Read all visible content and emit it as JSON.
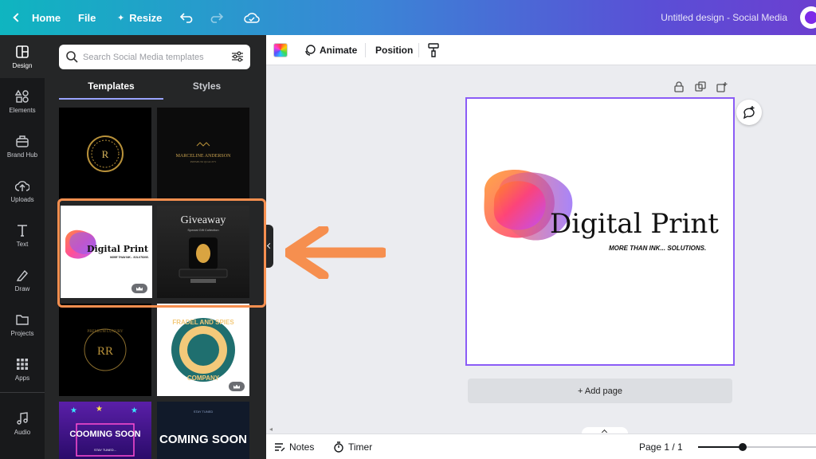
{
  "topbar": {
    "home_label": "Home",
    "file_label": "File",
    "resize_label": "Resize",
    "document_title": "Untitled design - Social Media"
  },
  "rail": {
    "items": [
      {
        "label": "Design",
        "icon": "layout-icon"
      },
      {
        "label": "Elements",
        "icon": "shapes-icon"
      },
      {
        "label": "Brand Hub",
        "icon": "briefcase-icon"
      },
      {
        "label": "Uploads",
        "icon": "upload-cloud-icon"
      },
      {
        "label": "Text",
        "icon": "text-icon"
      },
      {
        "label": "Draw",
        "icon": "pen-icon"
      },
      {
        "label": "Projects",
        "icon": "folder-icon"
      },
      {
        "label": "Apps",
        "icon": "grid-icon"
      },
      {
        "label": "Audio",
        "icon": "music-icon"
      }
    ]
  },
  "panel": {
    "search_placeholder": "Search Social Media templates",
    "tabs": [
      "Templates",
      "Styles"
    ],
    "templates": [
      {
        "id": "t1",
        "text": "R"
      },
      {
        "id": "t2",
        "text": "MARCELINE ANDERSON",
        "subtext": "PREMIUM QUALITY"
      },
      {
        "id": "t3",
        "title": "Digital Print",
        "subtitle": "MORE THAN INK... SOLUTIONS.",
        "premium": true
      },
      {
        "id": "t4",
        "title": "Giveaway",
        "subtitle": "Special Gift Collection"
      },
      {
        "id": "t5",
        "text": "PREMIUM LUXURY",
        "monogram": "RR"
      },
      {
        "id": "t6",
        "text": "FRADEL AND SPIES",
        "subtext": "COMPANY",
        "premium": true
      },
      {
        "id": "t7",
        "text": "COOMING SOON",
        "subtext": "STAY TUNED..."
      },
      {
        "id": "t8",
        "text": "COMING SOON",
        "subtext": "STAY TUNED"
      }
    ]
  },
  "toolbar": {
    "animate_label": "Animate",
    "position_label": "Position"
  },
  "canvas": {
    "title": "Digital Print",
    "tagline": "MORE THAN INK... SOLUTIONS.",
    "add_page_label": "+ Add page"
  },
  "bottombar": {
    "notes_label": "Notes",
    "timer_label": "Timer",
    "page_indicator": "Page 1 / 1",
    "zoom_fraction": 0.38
  },
  "colors": {
    "accent_purple": "#8b5cf6",
    "highlight_orange": "#f68f4f",
    "panel_bg": "#252627",
    "rail_bg": "#18191b"
  }
}
